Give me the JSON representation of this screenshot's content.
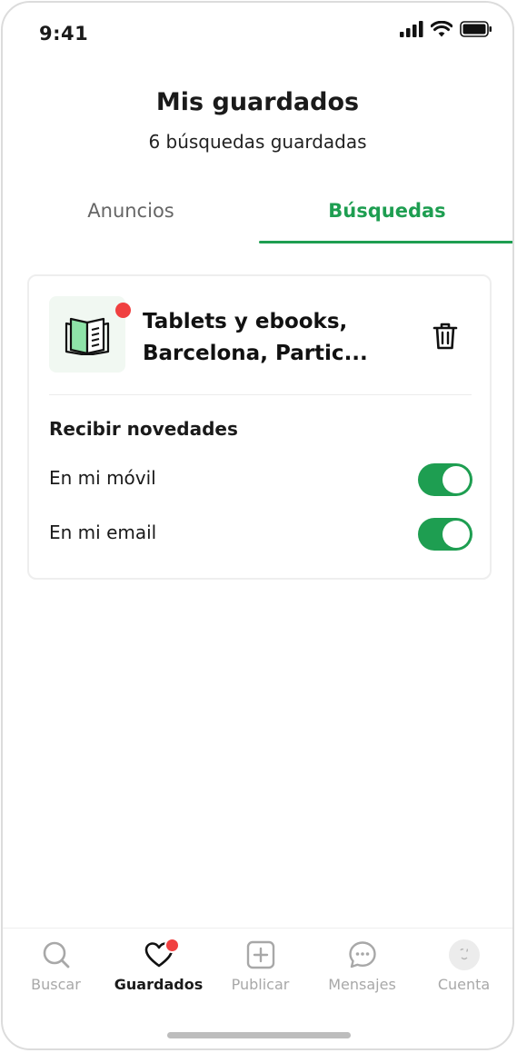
{
  "status_bar": {
    "time": "9:41"
  },
  "header": {
    "title": "Mis guardados",
    "subtitle": "6 búsquedas guardadas"
  },
  "tabs": [
    {
      "label": "Anuncios",
      "active": false
    },
    {
      "label": "Búsquedas",
      "active": true
    }
  ],
  "saved_search": {
    "title_line1": "Tablets y ebooks,",
    "title_line2": "Barcelona, Partic...",
    "has_new": true,
    "section_title": "Recibir novedades",
    "settings": [
      {
        "label": "En mi móvil",
        "enabled": true
      },
      {
        "label": "En mi email",
        "enabled": true
      }
    ]
  },
  "bottom_nav": [
    {
      "label": "Buscar",
      "icon": "search-icon",
      "active": false
    },
    {
      "label": "Guardados",
      "icon": "heart-icon",
      "active": true,
      "badge": true
    },
    {
      "label": "Publicar",
      "icon": "plus-square-icon",
      "active": false
    },
    {
      "label": "Mensajes",
      "icon": "chat-icon",
      "active": false
    },
    {
      "label": "Cuenta",
      "icon": "avatar-icon",
      "active": false
    }
  ],
  "colors": {
    "accent": "#1e9e51",
    "badge": "#f04040",
    "inactive": "#a8a8a8"
  }
}
